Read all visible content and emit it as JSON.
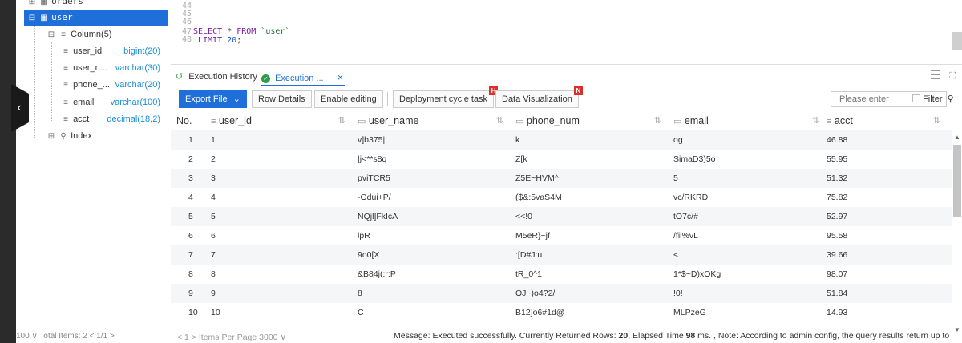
{
  "tree": {
    "orders_label": "orders",
    "user_label": "user",
    "column_group": "Column(5)",
    "columns": [
      {
        "name": "user_id",
        "type": "bigint(20)"
      },
      {
        "name": "user_n...",
        "type": "varchar(30)"
      },
      {
        "name": "phone_...",
        "type": "varchar(20)"
      },
      {
        "name": "email",
        "type": "varchar(100)"
      },
      {
        "name": "acct",
        "type": "decimal(18,2)"
      }
    ],
    "index_label": "Index",
    "footer": "100  ∨   Total Items: 2      <  1/1  >"
  },
  "editor": {
    "line_numbers": [
      "44",
      "45",
      "46",
      "47",
      "48"
    ],
    "line47_kw1": "SELECT",
    "line47_star": " * ",
    "line47_kw2": "FROM",
    "line47_tbl": " `user`",
    "line48_kw": " LIMIT",
    "line48_num": " 20",
    "line48_end": ";"
  },
  "tabs": {
    "history": "Execution History",
    "execution": "Execution ...",
    "close": "×"
  },
  "toolbar": {
    "export": "Export File",
    "row_details": "Row Details",
    "enable_editing": "Enable editing",
    "deployment": "Deployment cycle task",
    "deployment_badge": "H",
    "data_viz": "Data Visualization",
    "data_viz_badge": "N",
    "search_placeholder": "Please enter",
    "filter": "Filter"
  },
  "grid": {
    "headers": [
      "No.",
      "user_id",
      "user_name",
      "phone_num",
      "email",
      "acct"
    ],
    "rows": [
      [
        "1",
        "1",
        "v]b375|",
        "k",
        "og",
        "46.88"
      ],
      [
        "2",
        "2",
        "|j<**s8q",
        "Z[k",
        "SimaD3)5o",
        "55.95"
      ],
      [
        "3",
        "3",
        "pviTCR5",
        "Z5E~HVM^",
        "5",
        "51.32"
      ],
      [
        "4",
        "4",
        "-Odui+P/",
        "($&:5vaS4M",
        "vc/RKRD",
        "75.82"
      ],
      [
        "5",
        "5",
        "NQjl]FkIcA",
        "<<!0",
        "tO7c/#",
        "52.97"
      ],
      [
        "6",
        "6",
        "lpR",
        "M5eR}~jf",
        "/fil%vL",
        "95.58"
      ],
      [
        "7",
        "7",
        "9o0[X",
        ":[D#J:u",
        "<",
        "39.66"
      ],
      [
        "8",
        "8",
        "&B84j(:r:P",
        "tR_0^1",
        "1*$~D)xOKg",
        "98.07"
      ],
      [
        "9",
        "9",
        "8",
        "OJ~)o4?2/",
        "!0!",
        "51.84"
      ],
      [
        "10",
        "10",
        "C",
        "B12]o6#1d@",
        "MLPzeG",
        "14.93"
      ]
    ]
  },
  "pager": {
    "left": "<   1   >      Items Per Page   3000   ∨",
    "message_pre": "Message: Executed successfully. Currently Returned Rows: ",
    "rows": "20",
    "message_mid": ", Elapsed Time ",
    "ms": "98",
    "message_post": " ms. ,  Note: According to admin config, the query results return up to"
  }
}
